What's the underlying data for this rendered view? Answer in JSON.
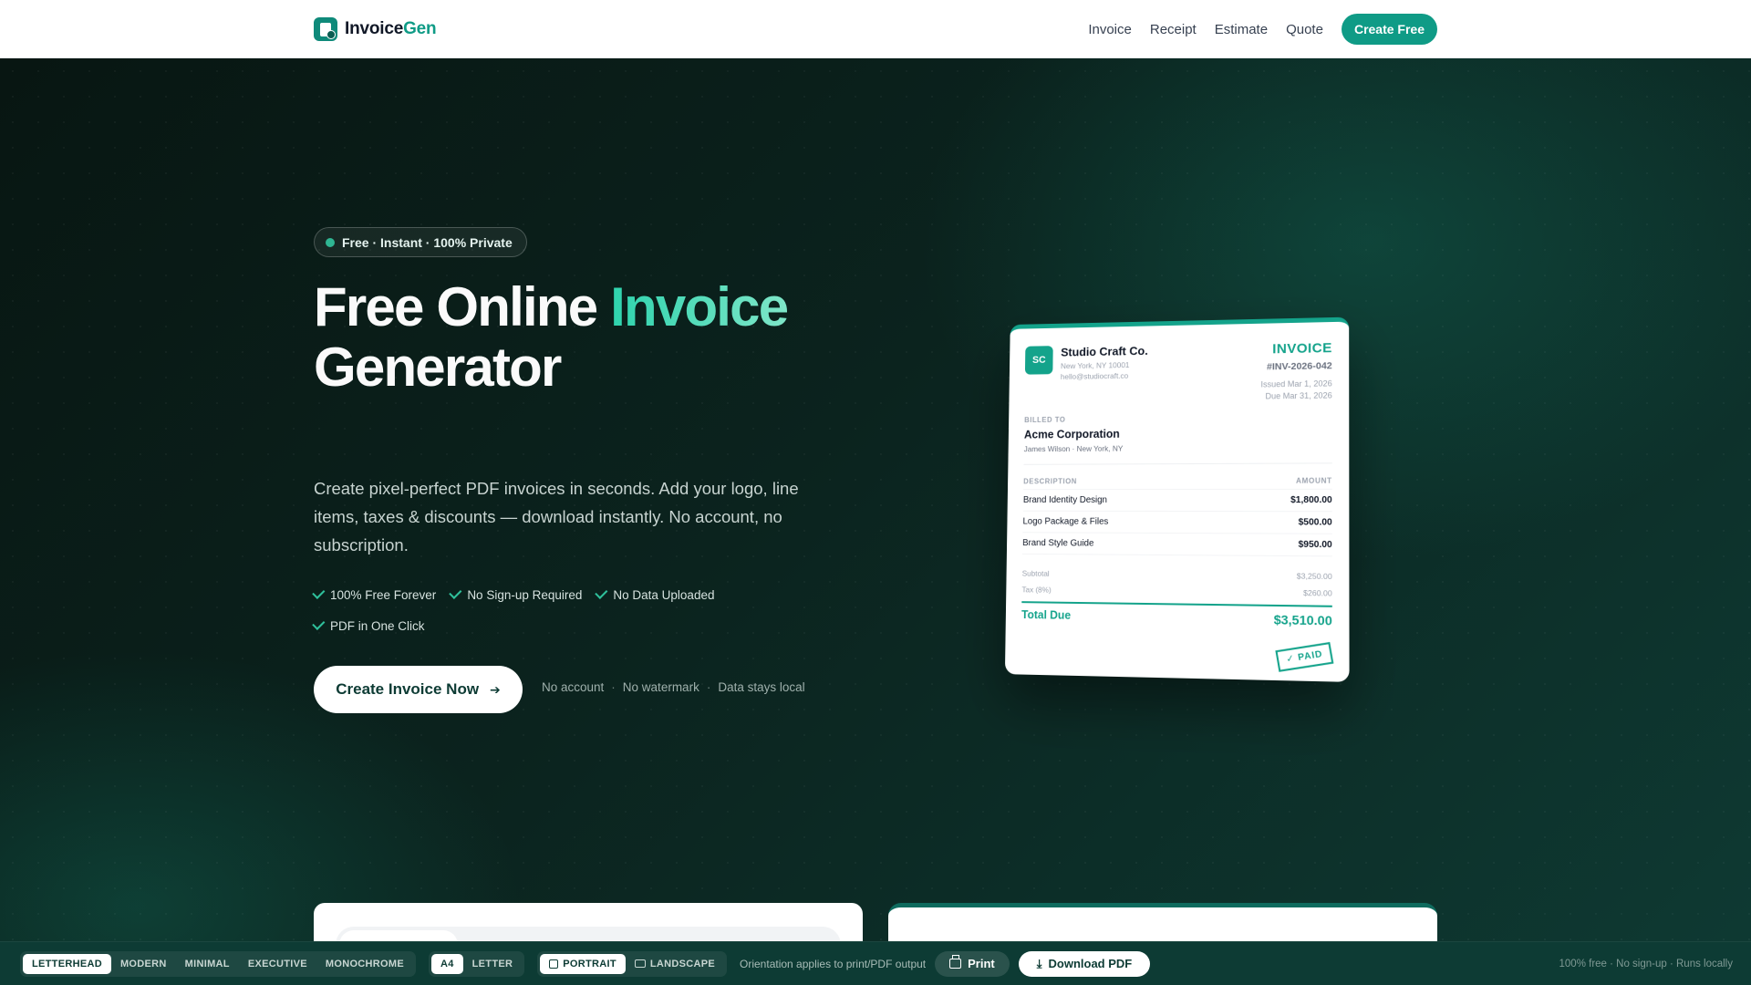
{
  "nav": {
    "brand_main": "Invoice",
    "brand_accent": "Gen",
    "links": [
      "Invoice",
      "Receipt",
      "Estimate",
      "Quote"
    ],
    "cta": "Create Free"
  },
  "hero": {
    "pill": "Free · Instant · 100% Private",
    "title_line1_a": "Free Online ",
    "title_line1_b": "Invoice",
    "title_line2": "Generator",
    "subtitle": "Create pixel-perfect PDF invoices in seconds. Add your logo, line items, taxes & discounts — download instantly. No account, no subscription.",
    "features": [
      "100% Free Forever",
      "No Sign-up Required",
      "No Data Uploaded",
      "PDF in One Click"
    ],
    "cta": "Create Invoice Now",
    "notes": [
      "No account",
      "No watermark",
      "Data stays local"
    ]
  },
  "invoice": {
    "monogram": "SC",
    "company": "Studio Craft Co.",
    "company_address": "New York, NY 10001",
    "company_email": "hello@studiocraft.co",
    "label": "INVOICE",
    "number": "#INV-2026-042",
    "issued": "Issued Mar 1, 2026",
    "due": "Due Mar 31, 2026",
    "billed_label": "BILLED TO",
    "client": "Acme Corporation",
    "client_sub": "James Wilson · New York, NY",
    "col_desc": "DESCRIPTION",
    "col_amount": "AMOUNT",
    "items": [
      {
        "desc": "Brand Identity Design",
        "amount": "$1,800.00"
      },
      {
        "desc": "Logo Package & Files",
        "amount": "$500.00"
      },
      {
        "desc": "Brand Style Guide",
        "amount": "$950.00"
      }
    ],
    "subtotal_label": "Subtotal",
    "subtotal": "$3,250.00",
    "tax_label": "Tax (8%)",
    "tax": "$260.00",
    "total_label": "Total Due",
    "total": "$3,510.00",
    "stamp": "✓ PAID"
  },
  "toolbar": {
    "themes": [
      "LETTERHEAD",
      "MODERN",
      "MINIMAL",
      "EXECUTIVE",
      "MONOCHROME"
    ],
    "sizes": [
      "A4",
      "LETTER"
    ],
    "orientations": [
      "PORTRAIT",
      "LANDSCAPE"
    ],
    "orientation_note": "Orientation applies to print/PDF output",
    "print": "Print",
    "download": "Download PDF",
    "right_note": "100% free · No sign-up · Runs locally"
  },
  "colors": {
    "accent": "#0f9b86",
    "hero_bg": "#0b231e",
    "toolbar_bg": "#0d3b34"
  }
}
